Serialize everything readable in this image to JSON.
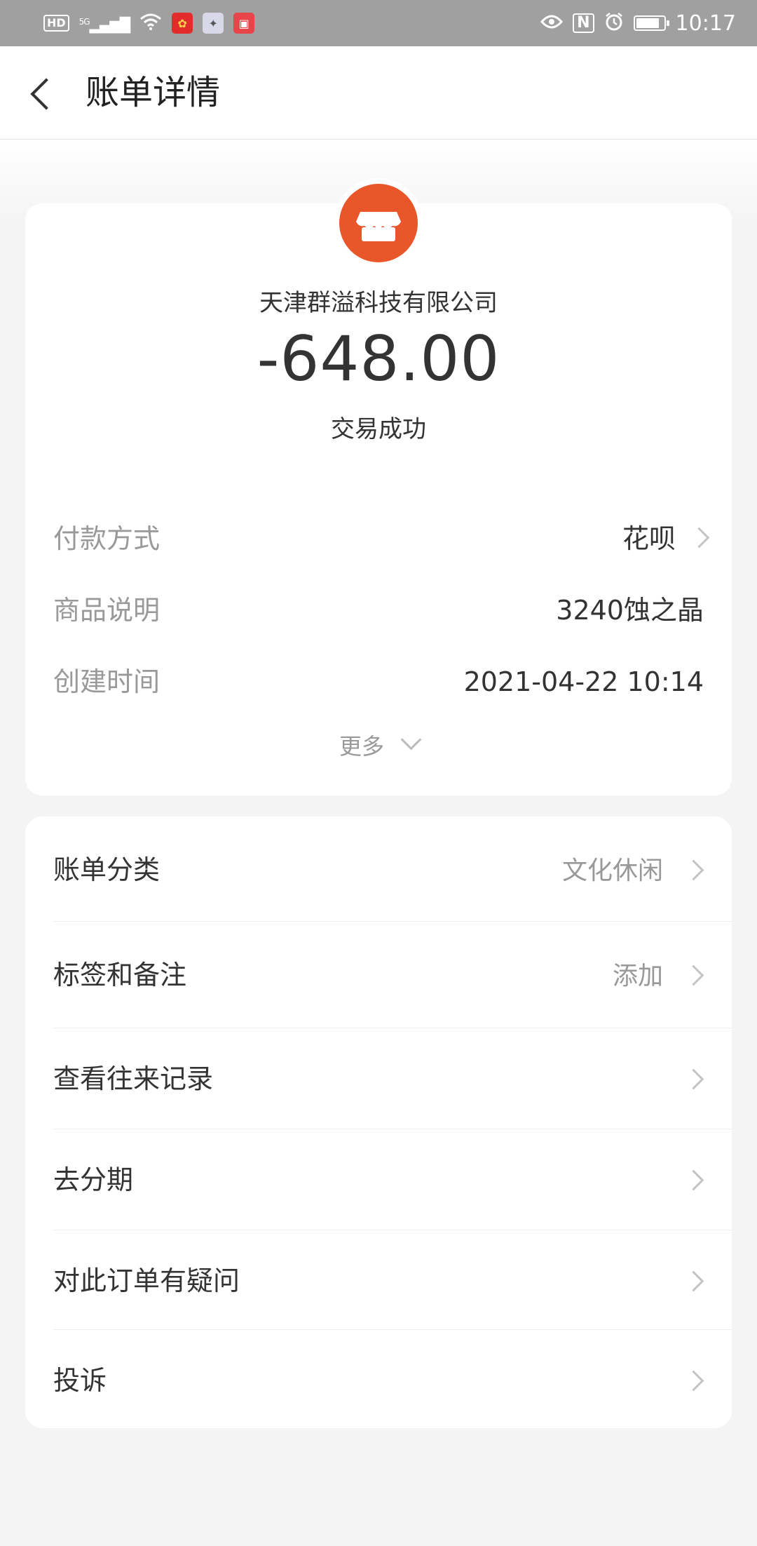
{
  "status_bar": {
    "hd": "HD",
    "network": "5G",
    "nfc": "N",
    "time": "10:17",
    "battery_level": 0.85
  },
  "header": {
    "title": "账单详情"
  },
  "bill": {
    "merchant": "天津群溢科技有限公司",
    "amount": "-648.00",
    "status": "交易成功",
    "brand_color": "#e8562a",
    "details": [
      {
        "label": "付款方式",
        "value": "花呗"
      },
      {
        "label": "商品说明",
        "value": "3240蚀之晶"
      },
      {
        "label": "创建时间",
        "value": "2021-04-22 10:14"
      }
    ],
    "more": "更多"
  },
  "actions": [
    {
      "label": "账单分类",
      "value": "文化休闲"
    },
    {
      "label": "标签和备注",
      "value": "添加"
    },
    {
      "label": "查看往来记录",
      "value": ""
    },
    {
      "label": "去分期",
      "value": ""
    },
    {
      "label": "对此订单有疑问",
      "value": ""
    },
    {
      "label": "投诉",
      "value": ""
    }
  ],
  "icons": {
    "back": "chevron-left-icon",
    "merchant": "shop-icon",
    "row_arrow": "chevron-right-icon",
    "more": "chevron-down-icon",
    "eye": "eye-icon",
    "alarm": "alarm-icon",
    "wifi": "wifi-icon"
  }
}
